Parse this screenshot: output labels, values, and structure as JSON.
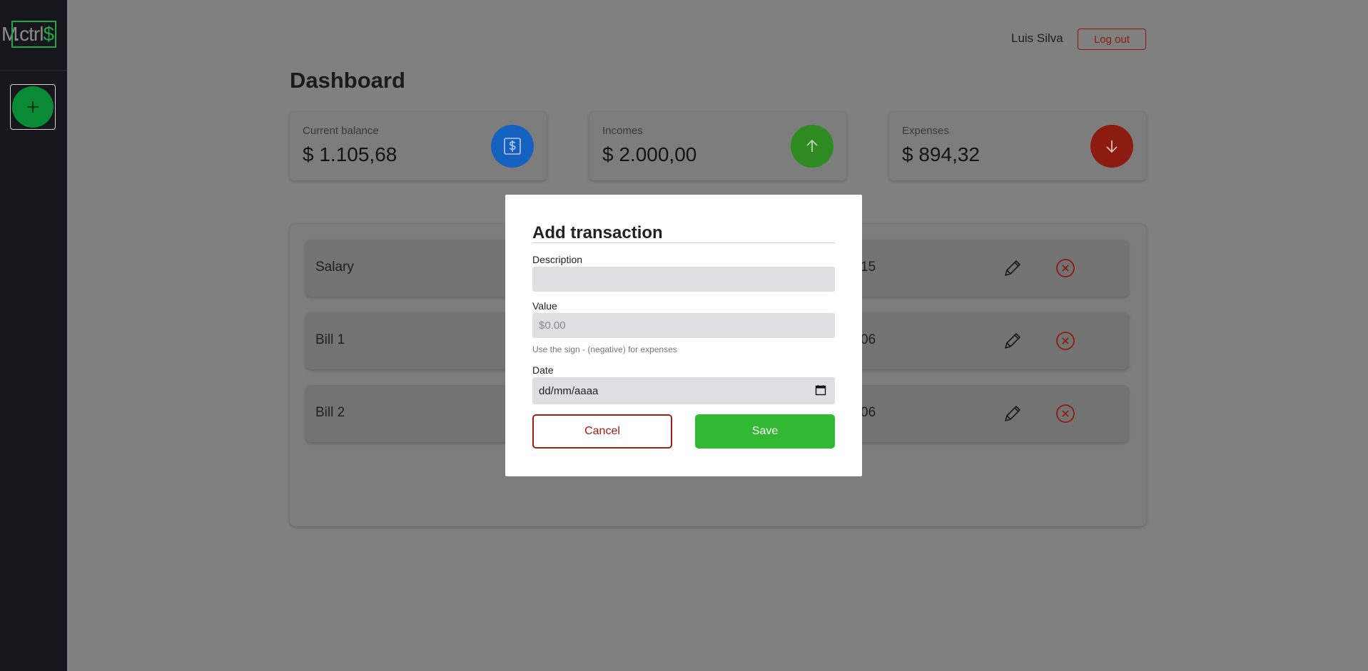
{
  "app": {
    "logo_prefix": "M",
    "logo_mid": ".ctrl",
    "logo_dollar": "$"
  },
  "header": {
    "user_name": "Luis Silva",
    "logout_label": "Log out"
  },
  "page_title": "Dashboard",
  "cards": [
    {
      "label": "Current balance",
      "value": "$ 1.105,68",
      "icon": "dollar-icon",
      "color": "#1461c0"
    },
    {
      "label": "Incomes",
      "value": "$ 2.000,00",
      "icon": "arrow-up-icon",
      "color": "#2e8b22"
    },
    {
      "label": "Expenses",
      "value": "$ 894,32",
      "icon": "arrow-down-icon",
      "color": "#8c1b12"
    }
  ],
  "transactions": [
    {
      "description": "Salary",
      "date_fragment": "15"
    },
    {
      "description": "Bill 1",
      "date_fragment": "06"
    },
    {
      "description": "Bill 2",
      "date_fragment": "06"
    }
  ],
  "modal": {
    "title": "Add transaction",
    "description_label": "Description",
    "description_value": "",
    "value_label": "Value",
    "value_placeholder": "$0.00",
    "hint": "Use the sign - (negative) for expenses",
    "date_label": "Date",
    "date_placeholder": "dd/mm/aaaa",
    "cancel_label": "Cancel",
    "save_label": "Save"
  }
}
